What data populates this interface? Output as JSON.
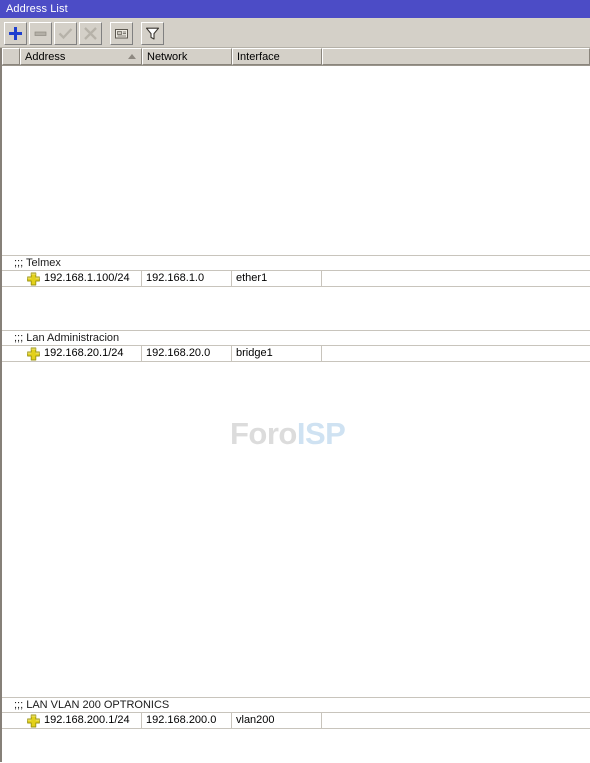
{
  "window": {
    "title": "Address List",
    "titlebar_color": "#4c4cc6",
    "toolbar_color": "#d4d0c8"
  },
  "toolbar": {
    "buttons": [
      {
        "name": "add-button",
        "icon": "plus-icon",
        "label": "Add",
        "enabled": true
      },
      {
        "name": "remove-button",
        "icon": "minus-icon",
        "label": "Remove",
        "enabled": false
      },
      {
        "name": "enable-button",
        "icon": "check-icon",
        "label": "Enable",
        "enabled": false
      },
      {
        "name": "disable-button",
        "icon": "cross-icon",
        "label": "Disable",
        "enabled": false
      },
      {
        "name": "comment-button",
        "icon": "comment-icon",
        "label": "Comment",
        "enabled": true
      },
      {
        "name": "filter-button",
        "icon": "funnel-icon",
        "label": "Filter",
        "enabled": true
      }
    ]
  },
  "table": {
    "columns": [
      {
        "key": "flag",
        "label": ""
      },
      {
        "key": "address",
        "label": "Address",
        "sorted": "asc"
      },
      {
        "key": "network",
        "label": "Network"
      },
      {
        "key": "interface",
        "label": "Interface"
      },
      {
        "key": "rest",
        "label": ""
      }
    ],
    "groups": [
      {
        "comment": ";;; Telmex",
        "rows": [
          {
            "flag_icon": "address-cross-icon",
            "address": "192.168.1.100/24",
            "network": "192.168.1.0",
            "interface": "ether1"
          }
        ]
      },
      {
        "comment": ";;; Lan Administracion",
        "rows": [
          {
            "flag_icon": "address-cross-icon",
            "address": "192.168.20.1/24",
            "network": "192.168.20.0",
            "interface": "bridge1"
          }
        ]
      },
      {
        "comment": ";;; LAN VLAN 200 OPTRONICS",
        "rows": [
          {
            "flag_icon": "address-cross-icon",
            "address": "192.168.200.1/24",
            "network": "192.168.200.0",
            "interface": "vlan200"
          }
        ]
      }
    ]
  },
  "watermark": {
    "part1": "Foro",
    "part2": "ISP",
    "color1": "#dcdcdc",
    "color2": "#cfe2f2"
  }
}
